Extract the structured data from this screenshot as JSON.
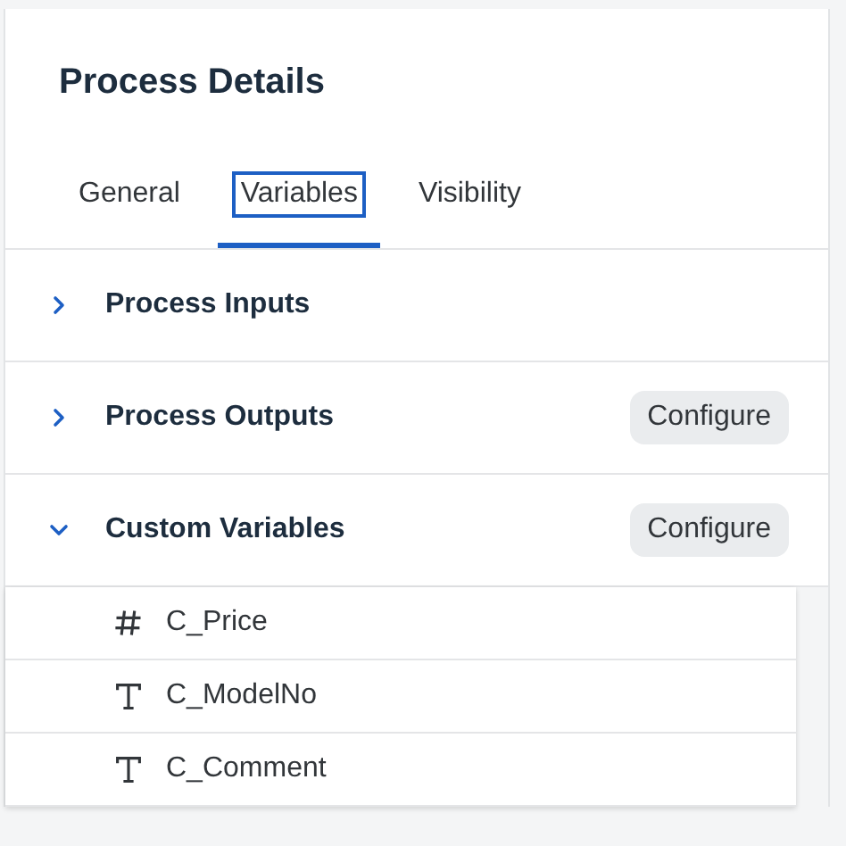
{
  "panel": {
    "title": "Process Details"
  },
  "tabs": [
    {
      "label": "General",
      "selected": false
    },
    {
      "label": "Variables",
      "selected": true
    },
    {
      "label": "Visibility",
      "selected": false
    }
  ],
  "sections": [
    {
      "label": "Process Inputs",
      "expanded": false
    },
    {
      "label": "Process Outputs",
      "expanded": false,
      "action": "Configure"
    },
    {
      "label": "Custom Variables",
      "expanded": true,
      "action": "Configure",
      "variables": [
        {
          "name": "C_Price",
          "kind": "number"
        },
        {
          "name": "C_ModelNo",
          "kind": "text"
        },
        {
          "name": "C_Comment",
          "kind": "text"
        }
      ]
    }
  ]
}
